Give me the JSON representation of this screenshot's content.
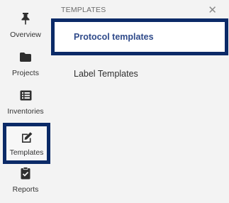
{
  "sidebar": {
    "items": [
      {
        "label": "Overview",
        "icon": "pin-icon",
        "active": false
      },
      {
        "label": "Projects",
        "icon": "folder-icon",
        "active": false
      },
      {
        "label": "Inventories",
        "icon": "list-icon",
        "active": false
      },
      {
        "label": "Templates",
        "icon": "edit-icon",
        "active": true
      },
      {
        "label": "Reports",
        "icon": "clipboard-check-icon",
        "active": false
      }
    ]
  },
  "panel": {
    "title": "TEMPLATES",
    "close_icon": "close-icon",
    "items": [
      {
        "label": "Protocol templates",
        "active": true
      },
      {
        "label": "Label Templates",
        "active": false
      }
    ]
  },
  "colors": {
    "highlight_border": "#0b2a67",
    "active_text": "#2f4a8a",
    "background": "#f3f3f3"
  }
}
